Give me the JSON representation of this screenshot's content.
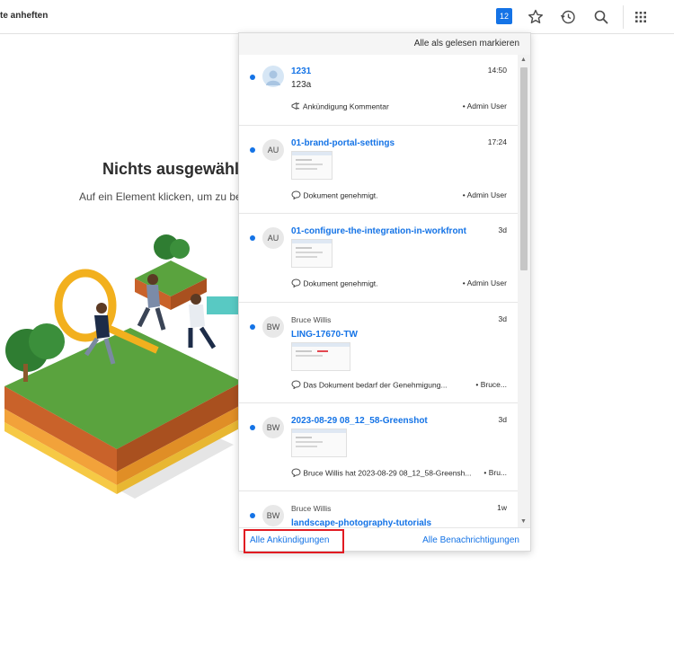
{
  "topbar": {
    "pin_label": "te anheften",
    "notification_count": "12",
    "icons": [
      "bell-badge",
      "star-icon",
      "history-icon",
      "search-icon",
      "apps-grid-icon"
    ]
  },
  "empty_state": {
    "title": "Nichts ausgewählt",
    "subtitle": "Auf ein Element klicken, um zu begi"
  },
  "panel": {
    "mark_all_read": "Alle als gelesen markieren",
    "items": [
      {
        "author": "",
        "title": "1231",
        "time": "14:50",
        "subtitle": "123a",
        "meta_icon": "megaphone-icon",
        "meta_text": "Ankündigung Kommentar",
        "meta_user": "Admin User",
        "avatar": ""
      },
      {
        "author": "",
        "title": "01-brand-portal-settings",
        "time": "17:24",
        "meta_icon": "comment-icon",
        "meta_text": "Dokument genehmigt.",
        "meta_user": "Admin User",
        "avatar": "AU"
      },
      {
        "author": "",
        "title": "01-configure-the-integration-in-workfront",
        "time": "3d",
        "meta_icon": "comment-icon",
        "meta_text": "Dokument genehmigt.",
        "meta_user": "Admin User",
        "avatar": "AU"
      },
      {
        "author": "Bruce Willis",
        "title": "LING-17670-TW",
        "time": "3d",
        "meta_icon": "comment-icon",
        "meta_text": "Das Dokument bedarf der Genehmigung...",
        "meta_user": "Bruce...",
        "avatar": "BW"
      },
      {
        "author": "",
        "title": "2023-08-29 08_12_58-Greenshot",
        "time": "3d",
        "meta_icon": "comment-icon",
        "meta_text": "Bruce Willis hat 2023-08-29 08_12_58-Greensh...",
        "meta_user": "Bru...",
        "avatar": "BW"
      },
      {
        "author": "Bruce Willis",
        "title": "landscape-photography-tutorials",
        "time": "1w",
        "avatar": "BW"
      }
    ],
    "footer_left": "Alle Ankündigungen",
    "footer_right": "Alle Benachrichtigungen"
  },
  "colors": {
    "accent": "#1473e6",
    "highlight": "#e11b22"
  }
}
